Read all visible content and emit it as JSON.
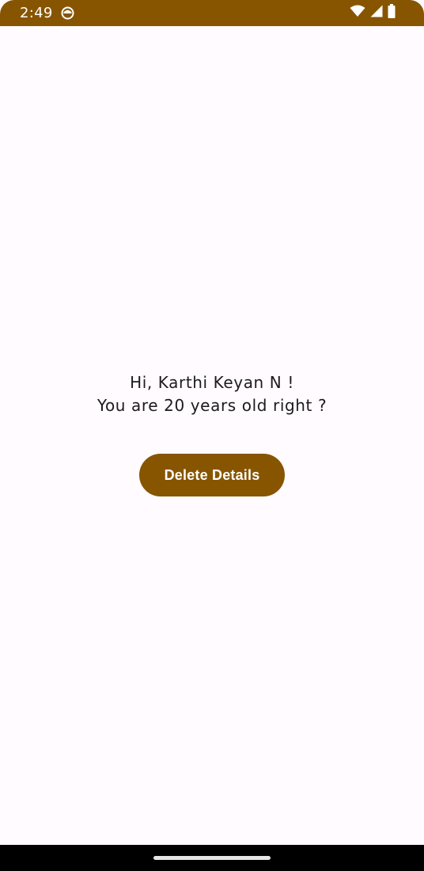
{
  "status_bar": {
    "time": "2:49",
    "app_icon": "android-notification-icon",
    "icons": [
      "wifi-icon",
      "cell-signal-icon",
      "battery-icon"
    ]
  },
  "main": {
    "greeting_line1": "Hi, Karthi Keyan N !",
    "greeting_line2": "You are 20 years old right ?",
    "delete_button_label": "Delete Details"
  },
  "colors": {
    "accent": "#875500",
    "background": "#fffbfe",
    "text": "#1d1b1e",
    "nav_bar": "#000000"
  }
}
